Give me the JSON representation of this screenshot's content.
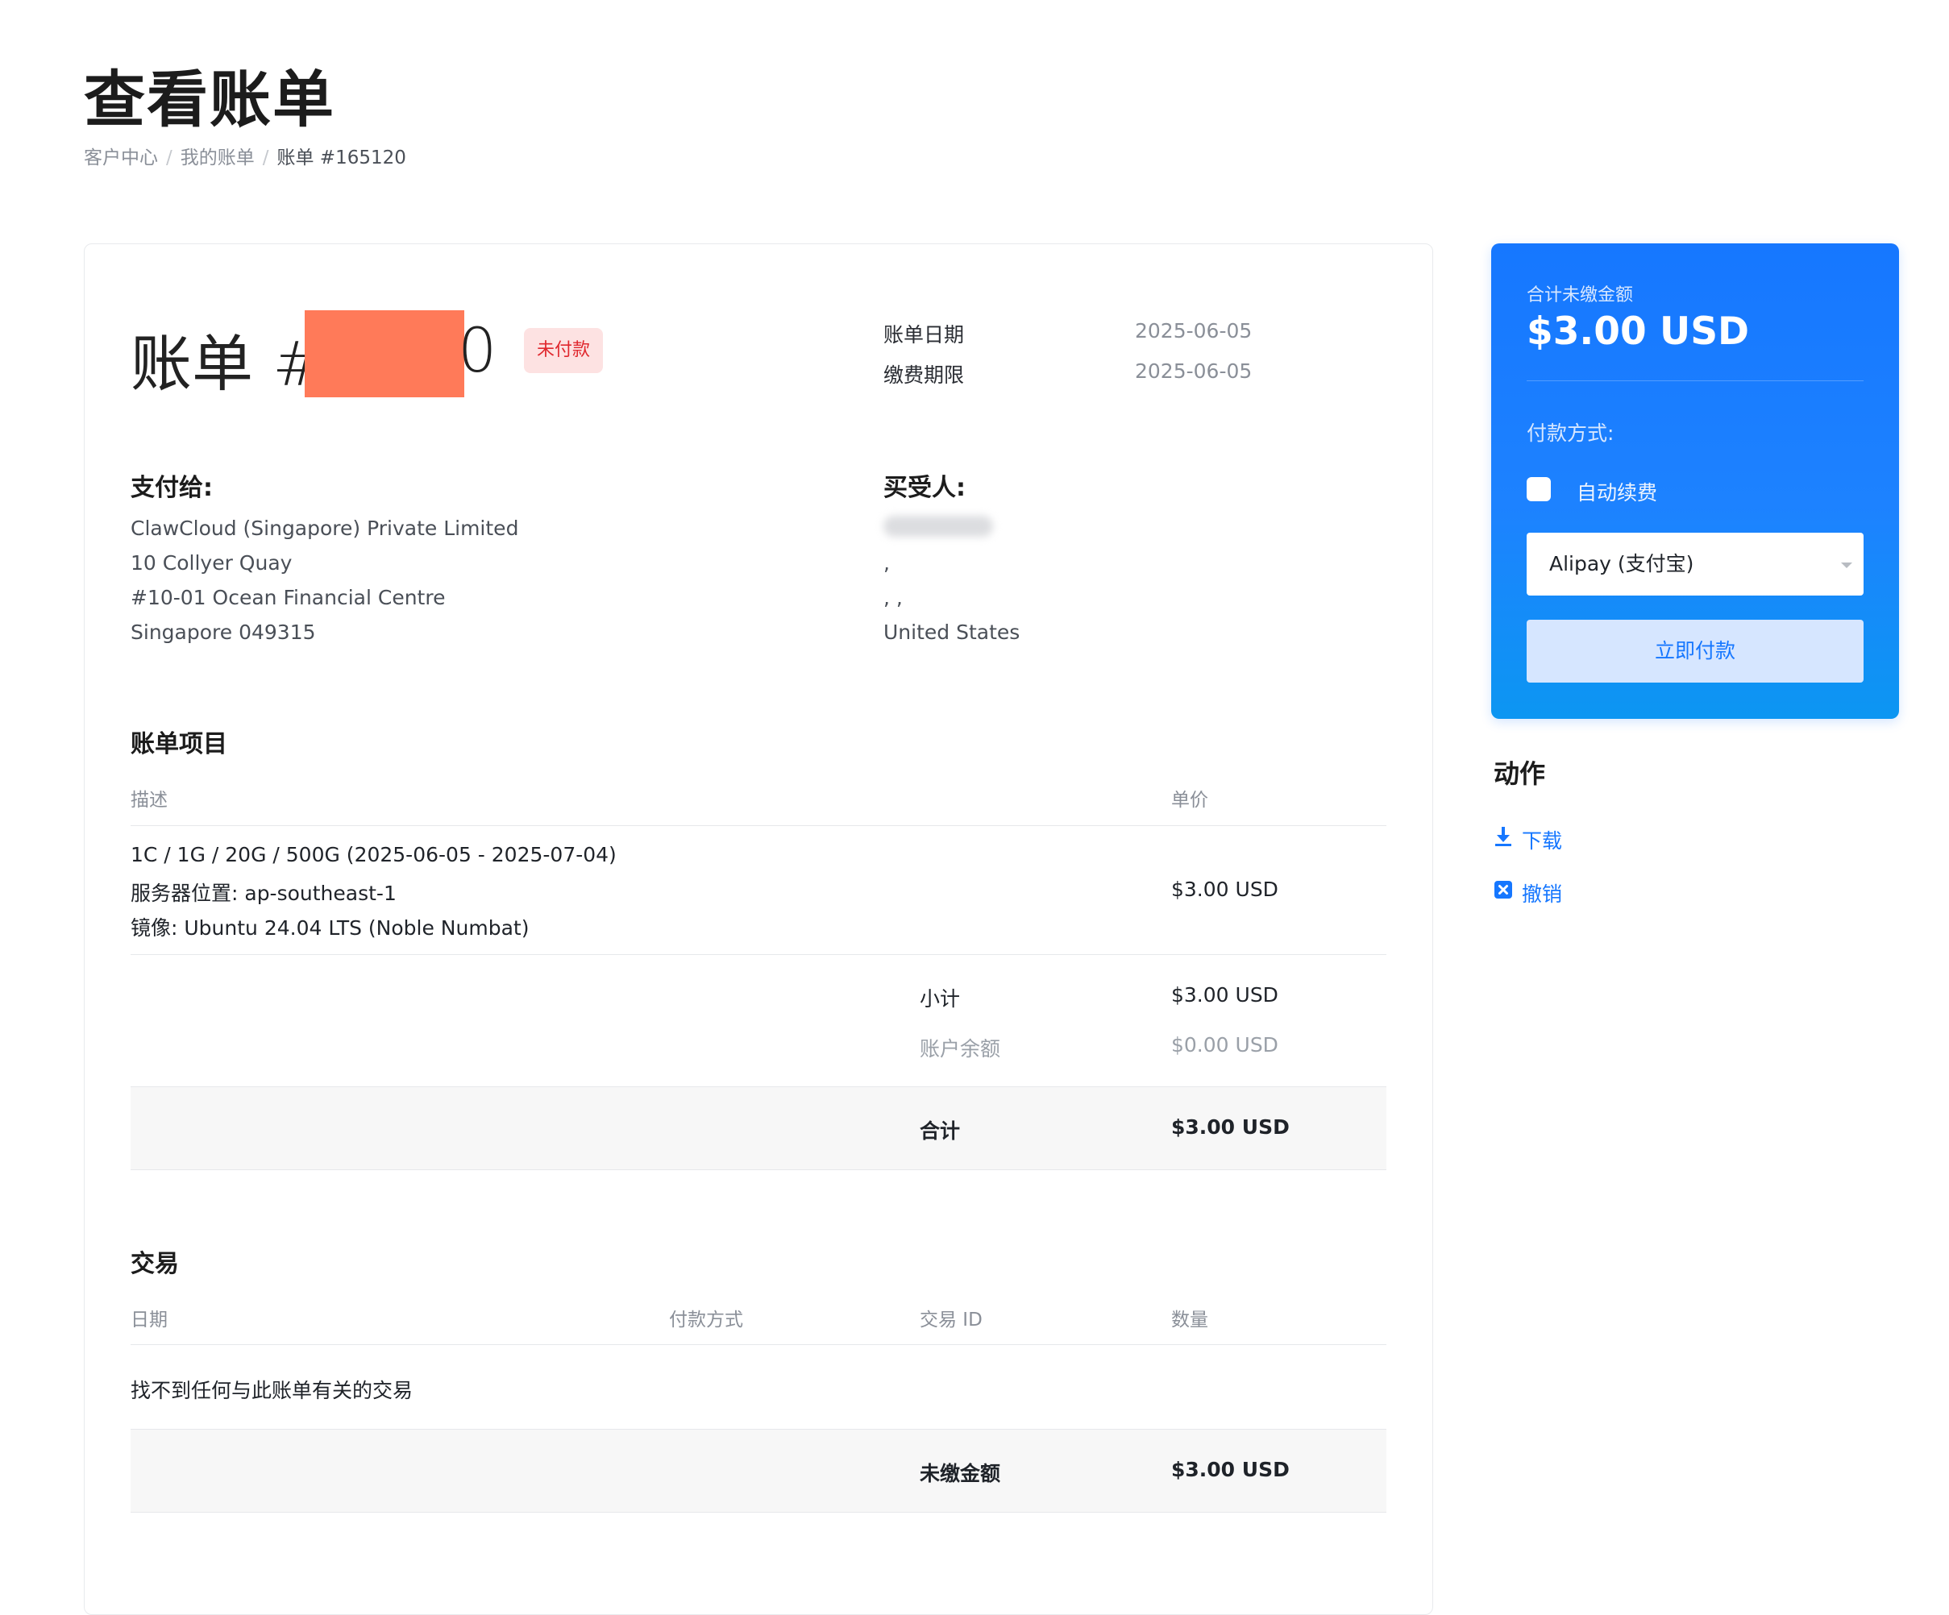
{
  "header": {
    "title": "查看账单",
    "breadcrumb": [
      "客户中心",
      "我的账单",
      "账单 #165120"
    ]
  },
  "invoice": {
    "title_prefix": "账单 #1",
    "title_suffix": "0",
    "status": "未付款",
    "invoice_date_label": "账单日期",
    "invoice_date": "2025-06-05",
    "due_date_label": "缴费期限",
    "due_date": "2025-06-05"
  },
  "pay_to": {
    "heading": "支付给:",
    "lines": [
      "ClawCloud (Singapore) Private Limited",
      "10 Collyer Quay",
      "#10-01 Ocean Financial Centre",
      "Singapore 049315"
    ]
  },
  "invoiced_to": {
    "heading": "买受人:",
    "lines": [
      ",",
      ", ,",
      "United States"
    ]
  },
  "items": {
    "heading": "账单项目",
    "col_desc": "描述",
    "col_price": "单价",
    "rows": [
      {
        "desc_lines": [
          "1C / 1G / 20G / 500G (2025-06-05 - 2025-07-04)",
          "服务器位置: ap-southeast-1",
          "镜像: Ubuntu 24.04 LTS (Noble Numbat)"
        ],
        "price": "$3.00 USD"
      }
    ],
    "subtotal_label": "小计",
    "subtotal": "$3.00 USD",
    "credit_label": "账户余额",
    "credit": "$0.00 USD",
    "total_label": "合计",
    "total": "$3.00 USD"
  },
  "transactions": {
    "heading": "交易",
    "col_date": "日期",
    "col_method": "付款方式",
    "col_id": "交易 ID",
    "col_amount": "数量",
    "empty": "找不到任何与此账单有关的交易",
    "balance_label": "未缴金额",
    "balance": "$3.00 USD"
  },
  "pay_panel": {
    "total_due_label": "合计未缴金额",
    "total_due": "$3.00 USD",
    "method_label": "付款方式:",
    "auto_renew_label": "自动续费",
    "selected_method": "Alipay (支付宝)",
    "pay_button": "立即付款",
    "accent": "#1677ff"
  },
  "actions": {
    "heading": "动作",
    "download": "下载",
    "cancel": "撤销",
    "download_icon": "download-icon",
    "cancel_icon": "close-square-icon"
  }
}
